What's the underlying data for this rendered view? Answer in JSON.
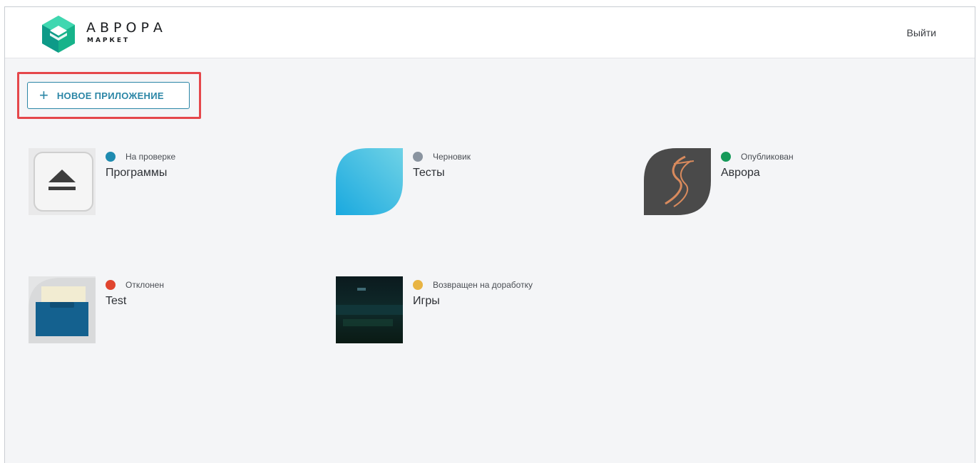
{
  "header": {
    "logo_title": "АВРОРА",
    "logo_subtitle": "МАРКЕТ",
    "logout_label": "Выйти"
  },
  "toolbar": {
    "new_app_icon": "+",
    "new_app_label": "НОВОЕ ПРИЛОЖЕНИЕ"
  },
  "apps": [
    {
      "name": "Программы",
      "status": "На проверке",
      "status_color": "#1f8bb0",
      "icon": "eject-icon"
    },
    {
      "name": "Тесты",
      "status": "Черновик",
      "status_color": "#8a94a0",
      "icon": "leaf-icon"
    },
    {
      "name": "Аврора",
      "status": "Опубликован",
      "status_color": "#169a5a",
      "icon": "aurora-app-icon"
    },
    {
      "name": "Test",
      "status": "Отклонен",
      "status_color": "#e0452f",
      "icon": "folder-icon"
    },
    {
      "name": "Игры",
      "status": "Возвращен на доработку",
      "status_color": "#e8b443",
      "icon": "game-screenshot-icon"
    }
  ],
  "colors": {
    "accent": "#2b86a6",
    "highlight": "#e5474b",
    "background": "#f4f5f7"
  }
}
